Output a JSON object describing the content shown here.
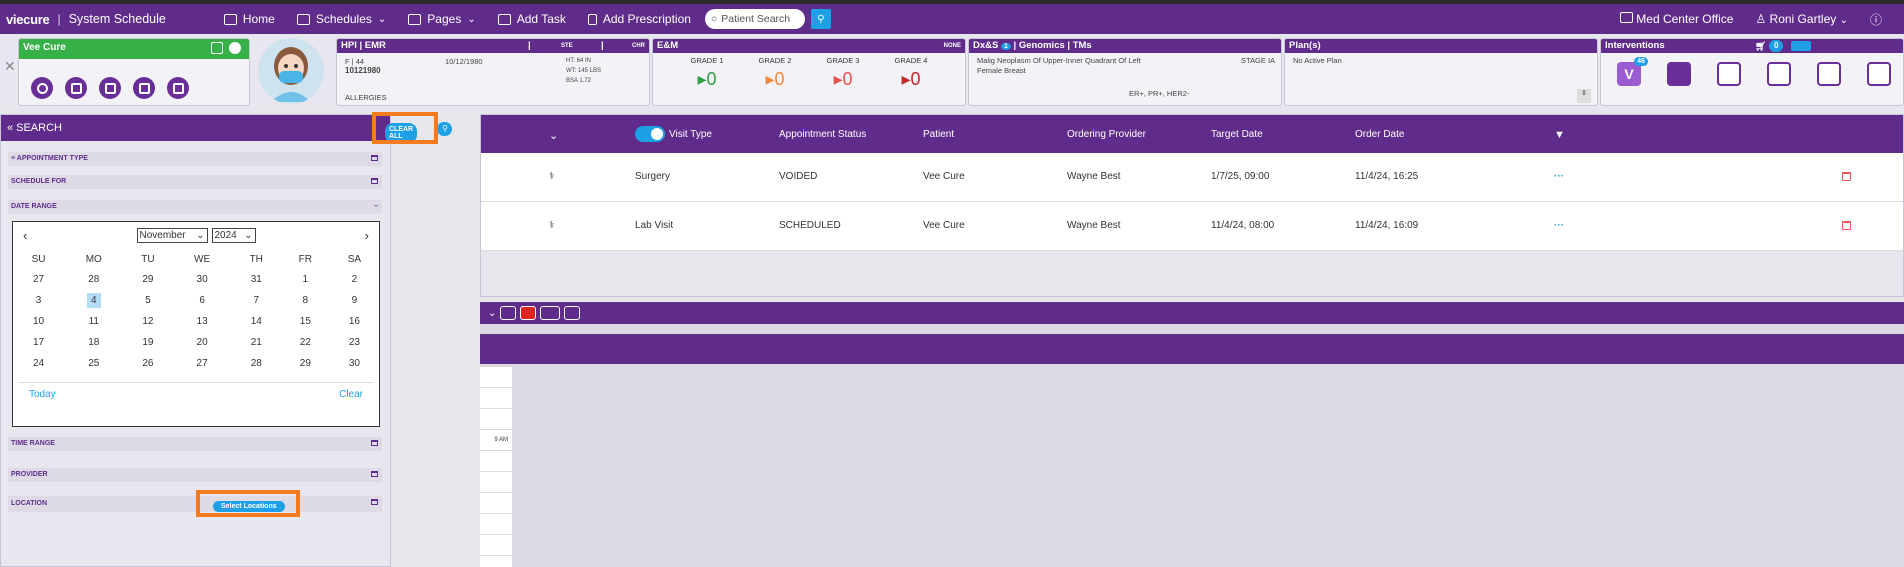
{
  "app": {
    "logo": "viecure",
    "title": "System Schedule",
    "nav": {
      "home": "Home",
      "schedules": "Schedules",
      "pages": "Pages",
      "add_task": "Add Task",
      "add_rx": "Add Prescription"
    },
    "search_placeholder": "Patient Search",
    "office": "Med Center Office",
    "user": "Roni Gartley"
  },
  "patient": {
    "name": "Vee Cure",
    "hpi_title": "HPI | EMR",
    "ste": "STE",
    "chr": "CHR",
    "sex_age": "F | 44",
    "dob": "10/12/1980",
    "mrn": "10121980",
    "ht": "HT: 64 IN",
    "wt": "WT: 145 LBS",
    "bsa": "BSA 1.72",
    "allergies": "ALLERGIES"
  },
  "em": {
    "title": "E&M",
    "none": "NONE",
    "grades": [
      {
        "label": "GRADE 1",
        "value": "0",
        "color": "#2ea043"
      },
      {
        "label": "GRADE 2",
        "value": "0",
        "color": "#f0883e"
      },
      {
        "label": "GRADE 3",
        "value": "0",
        "color": "#e5534b"
      },
      {
        "label": "GRADE 4",
        "value": "0",
        "color": "#c62828"
      }
    ]
  },
  "dx": {
    "title": "Dx&S",
    "badge": "1",
    "title2": "| Genomics | TMs",
    "text": "Malig Neoplasm Of Upper-Inner Quadrant Of Left Female Breast",
    "stage": "STAGE IA",
    "markers": "ER+, PR+, HER2-"
  },
  "plan": {
    "title": "Plan(s)",
    "text": "No Active Plan"
  },
  "interventions": {
    "title": "Interventions",
    "cart": "0",
    "v_badge": "46"
  },
  "search": {
    "title": "SEARCH",
    "clear_all": "CLEAR ALL",
    "sections": {
      "appt_type": "APPOINTMENT TYPE",
      "schedule_for": "SCHEDULE FOR",
      "date_range": "DATE RANGE",
      "time_range": "TIME RANGE",
      "provider": "PROVIDER",
      "location": "LOCATION"
    },
    "select_locations": "Select Locations"
  },
  "calendar": {
    "month": "November",
    "year": "2024",
    "days": [
      "SU",
      "MO",
      "TU",
      "WE",
      "TH",
      "FR",
      "SA"
    ],
    "weeks": [
      [
        "27",
        "28",
        "29",
        "30",
        "31",
        "1",
        "2"
      ],
      [
        "3",
        "4",
        "5",
        "6",
        "7",
        "8",
        "9"
      ],
      [
        "10",
        "11",
        "12",
        "13",
        "14",
        "15",
        "16"
      ],
      [
        "17",
        "18",
        "19",
        "20",
        "21",
        "22",
        "23"
      ],
      [
        "24",
        "25",
        "26",
        "27",
        "28",
        "29",
        "30"
      ]
    ],
    "today": "Today",
    "clear": "Clear"
  },
  "appointments": {
    "headers": {
      "visit_type": "Visit Type",
      "status": "Appointment Status",
      "patient": "Patient",
      "provider": "Ordering Provider",
      "target": "Target Date",
      "order": "Order Date"
    },
    "rows": [
      {
        "type": "Surgery",
        "status": "VOIDED",
        "patient": "Vee Cure",
        "provider": "Wayne Best",
        "target": "1/7/25, 09:00",
        "order": "11/4/24, 16:25"
      },
      {
        "type": "Lab Visit",
        "status": "SCHEDULED",
        "patient": "Vee Cure",
        "provider": "Wayne Best",
        "target": "11/4/24, 08:00",
        "order": "11/4/24, 16:09"
      }
    ]
  },
  "schedule": {
    "time_label": "9 AM"
  },
  "colors": {
    "brand": "#5f2c8c",
    "accent": "#1ea0e6",
    "highlight": "#f47b20",
    "green": "#38b048"
  }
}
